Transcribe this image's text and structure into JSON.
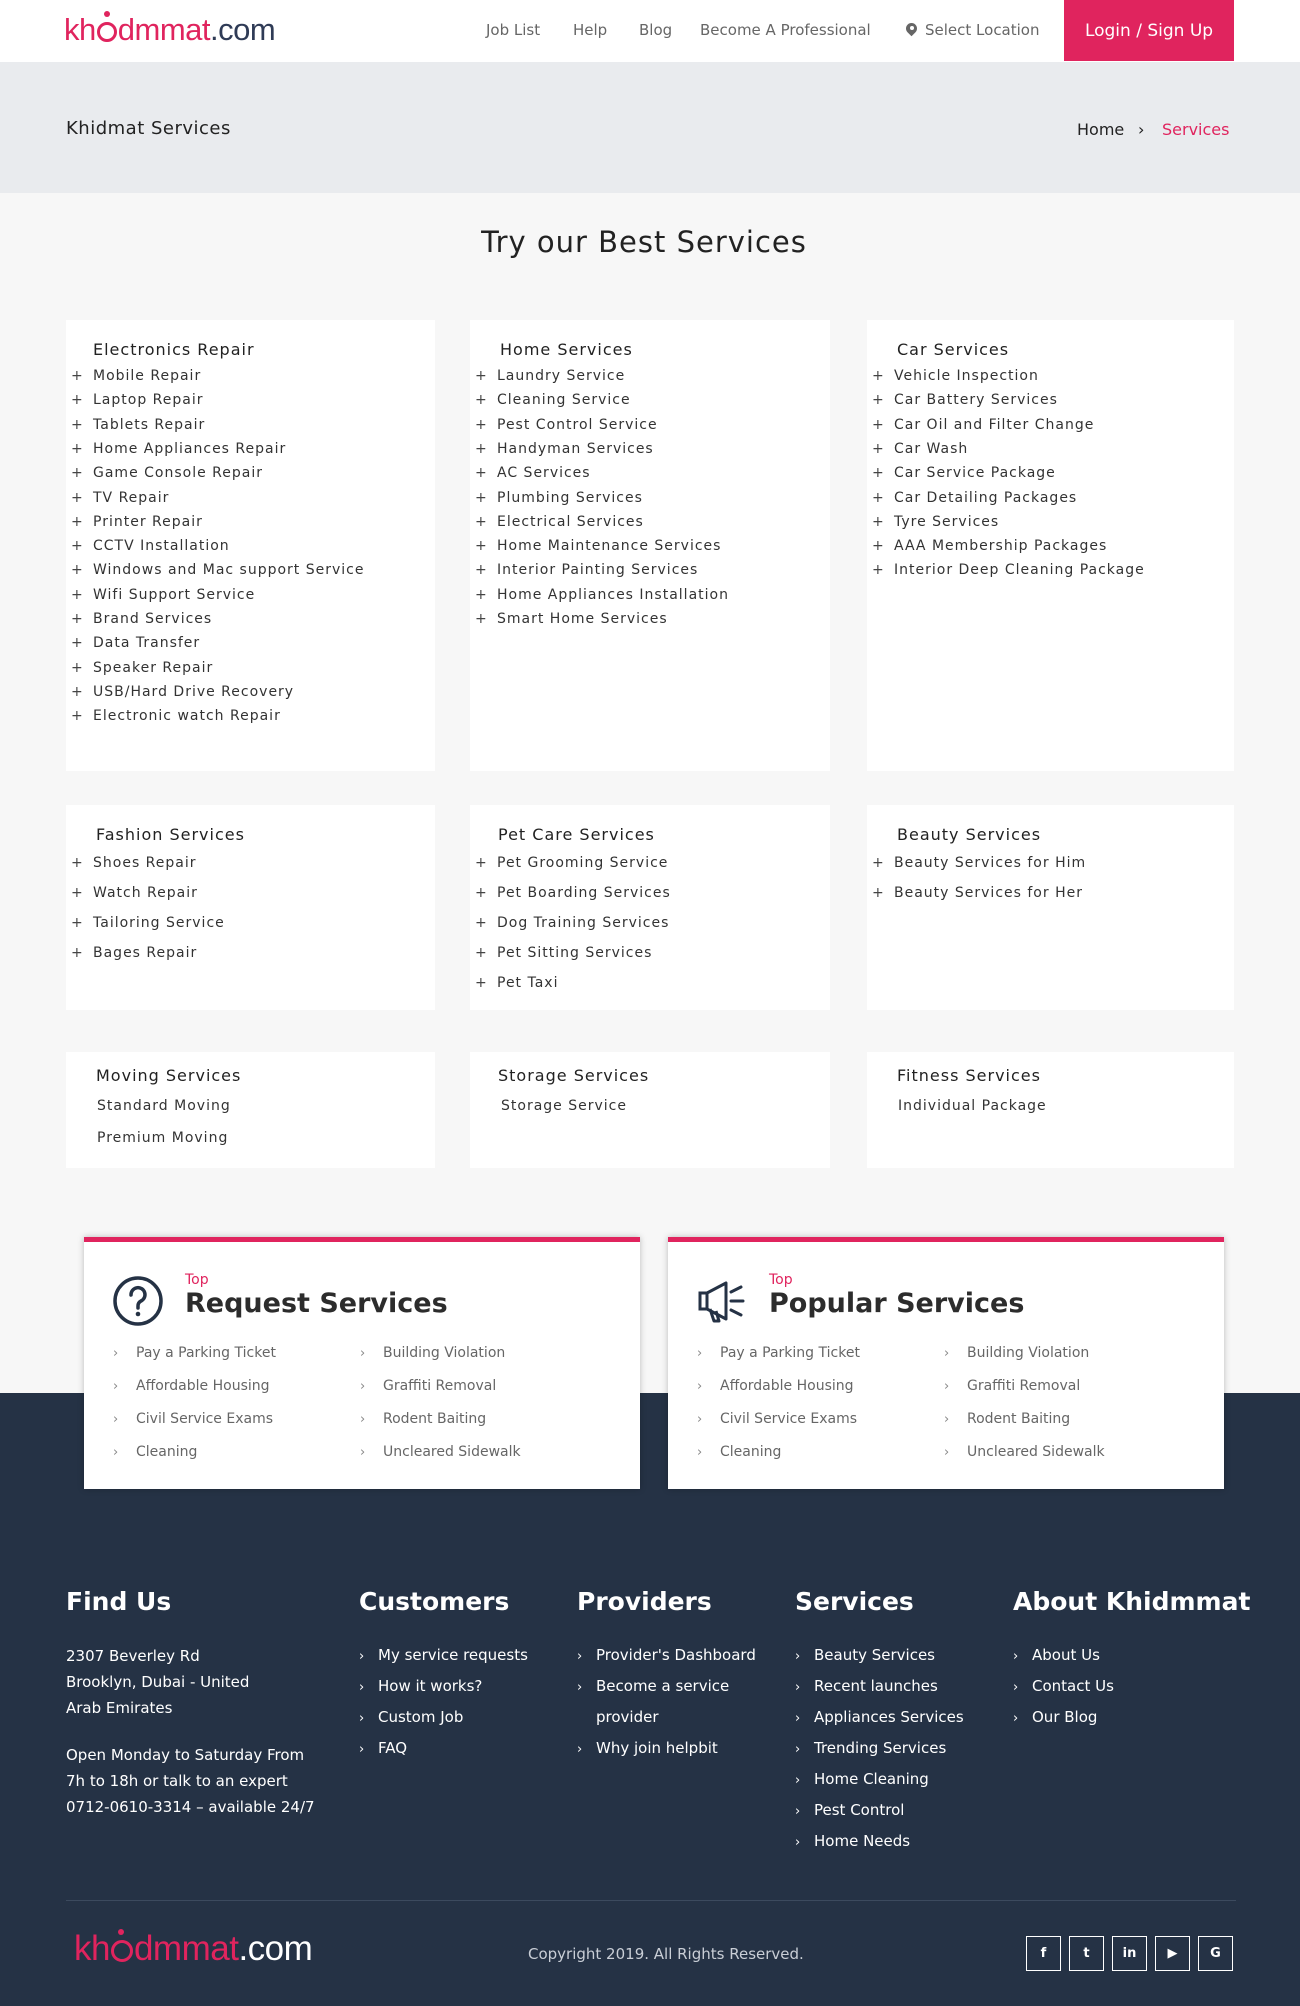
{
  "header": {
    "logo": {
      "kh": "kh",
      "dm": "dmmat",
      "com": ".com"
    },
    "nav": [
      "Job List",
      "Help",
      "Blog",
      "Become A Professional"
    ],
    "location": "Select Location",
    "login": "Login / Sign Up"
  },
  "band": {
    "title": "Khidmat Services",
    "crumb_home": "Home",
    "crumb_sep": "›",
    "crumb_current": "Services"
  },
  "main": {
    "heading": "Try our Best Services"
  },
  "categories": [
    {
      "title": "Electronics Repair",
      "items": [
        "Mobile Repair",
        "Laptop Repair",
        "Tablets Repair",
        "Home Appliances Repair",
        "Game Console Repair",
        "TV Repair",
        "Printer Repair",
        "CCTV Installation",
        "Windows and Mac support Service",
        "Wifi Support Service",
        "Brand Services",
        "Data Transfer",
        "Speaker Repair",
        "USB/Hard Drive Recovery",
        "Electronic watch Repair"
      ]
    },
    {
      "title": "Home Services",
      "items": [
        "Laundry Service",
        "Cleaning Service",
        "Pest Control Service",
        "Handyman Services",
        "AC Services",
        "Plumbing Services",
        "Electrical Services",
        "Home Maintenance Services",
        "Interior Painting Services",
        "Home Appliances Installation",
        "Smart Home Services"
      ]
    },
    {
      "title": "Car Services",
      "items": [
        "Vehicle Inspection",
        "Car Battery Services",
        "Car Oil and Filter Change",
        "Car Wash",
        "Car Service Package",
        "Car Detailing Packages",
        "Tyre Services",
        "AAA Membership Packages",
        "Interior Deep Cleaning Package"
      ]
    },
    {
      "title": "Fashion Services",
      "items": [
        "Shoes Repair",
        "Watch Repair",
        "Tailoring Service",
        "Bages Repair"
      ]
    },
    {
      "title": "Pet Care Services",
      "items": [
        "Pet Grooming Service",
        "Pet Boarding Services",
        "Dog Training Services",
        "Pet Sitting Services",
        "Pet Taxi"
      ]
    },
    {
      "title": "Beauty Services",
      "items": [
        "Beauty Services for Him",
        "Beauty Services for Her"
      ]
    },
    {
      "title": "Moving Services",
      "items": [
        "Standard Moving",
        "Premium Moving"
      ]
    },
    {
      "title": "Storage Services",
      "items": [
        "Storage Service"
      ]
    },
    {
      "title": "Fitness Services",
      "items": [
        "Individual Package"
      ]
    }
  ],
  "plus_symbol": "+",
  "top_boxes": [
    {
      "small": "Top",
      "title": "Request Services",
      "icon": "question-circle-icon",
      "links": [
        "Pay a Parking Ticket",
        "Building Violation",
        "Affordable Housing",
        "Graffiti Removal",
        "Civil Service Exams",
        "Rodent Baiting",
        "Cleaning",
        "Uncleared Sidewalk"
      ]
    },
    {
      "small": "Top",
      "title": "Popular Services",
      "icon": "megaphone-icon",
      "links": [
        "Pay a Parking Ticket",
        "Building Violation",
        "Affordable Housing",
        "Graffiti Removal",
        "Civil Service Exams",
        "Rodent Baiting",
        "Cleaning",
        "Uncleared Sidewalk"
      ]
    }
  ],
  "footer": {
    "find_us": {
      "title": "Find Us",
      "address": [
        "2307 Beverley Rd",
        "Brooklyn, Dubai - United",
        "Arab Emirates"
      ],
      "hours": [
        "Open Monday to Saturday From",
        "7h to 18h or talk to an expert",
        "0712-0610-3314 – available 24/7"
      ]
    },
    "customers": {
      "title": "Customers",
      "links": [
        "My service requests",
        "How it works?",
        "Custom Job",
        "FAQ"
      ]
    },
    "providers": {
      "title": "Providers",
      "links": [
        "Provider's Dashboard",
        "Become a service",
        "provider",
        "Why join helpbit"
      ]
    },
    "services": {
      "title": "Services",
      "links": [
        "Beauty Services",
        "Recent launches",
        "Appliances Services",
        "Trending Services",
        "Home Cleaning",
        "Pest Control",
        "Home Needs"
      ]
    },
    "about": {
      "title": "About Khidmmat",
      "links": [
        "About Us",
        "Contact Us",
        "Our Blog"
      ]
    },
    "copyright": "Copyright 2019. All Rights Reserved.",
    "social": [
      {
        "icon": "facebook-icon",
        "glyph": "f"
      },
      {
        "icon": "twitter-icon",
        "glyph": "t"
      },
      {
        "icon": "linkedin-icon",
        "glyph": "in"
      },
      {
        "icon": "youtube-icon",
        "glyph": "▶"
      },
      {
        "icon": "google-icon",
        "glyph": "G"
      }
    ]
  },
  "colors": {
    "accent": "#e0245e",
    "footer_bg": "#253245",
    "band_bg": "#e9ebee",
    "logo_dark": "#2f3b56"
  }
}
